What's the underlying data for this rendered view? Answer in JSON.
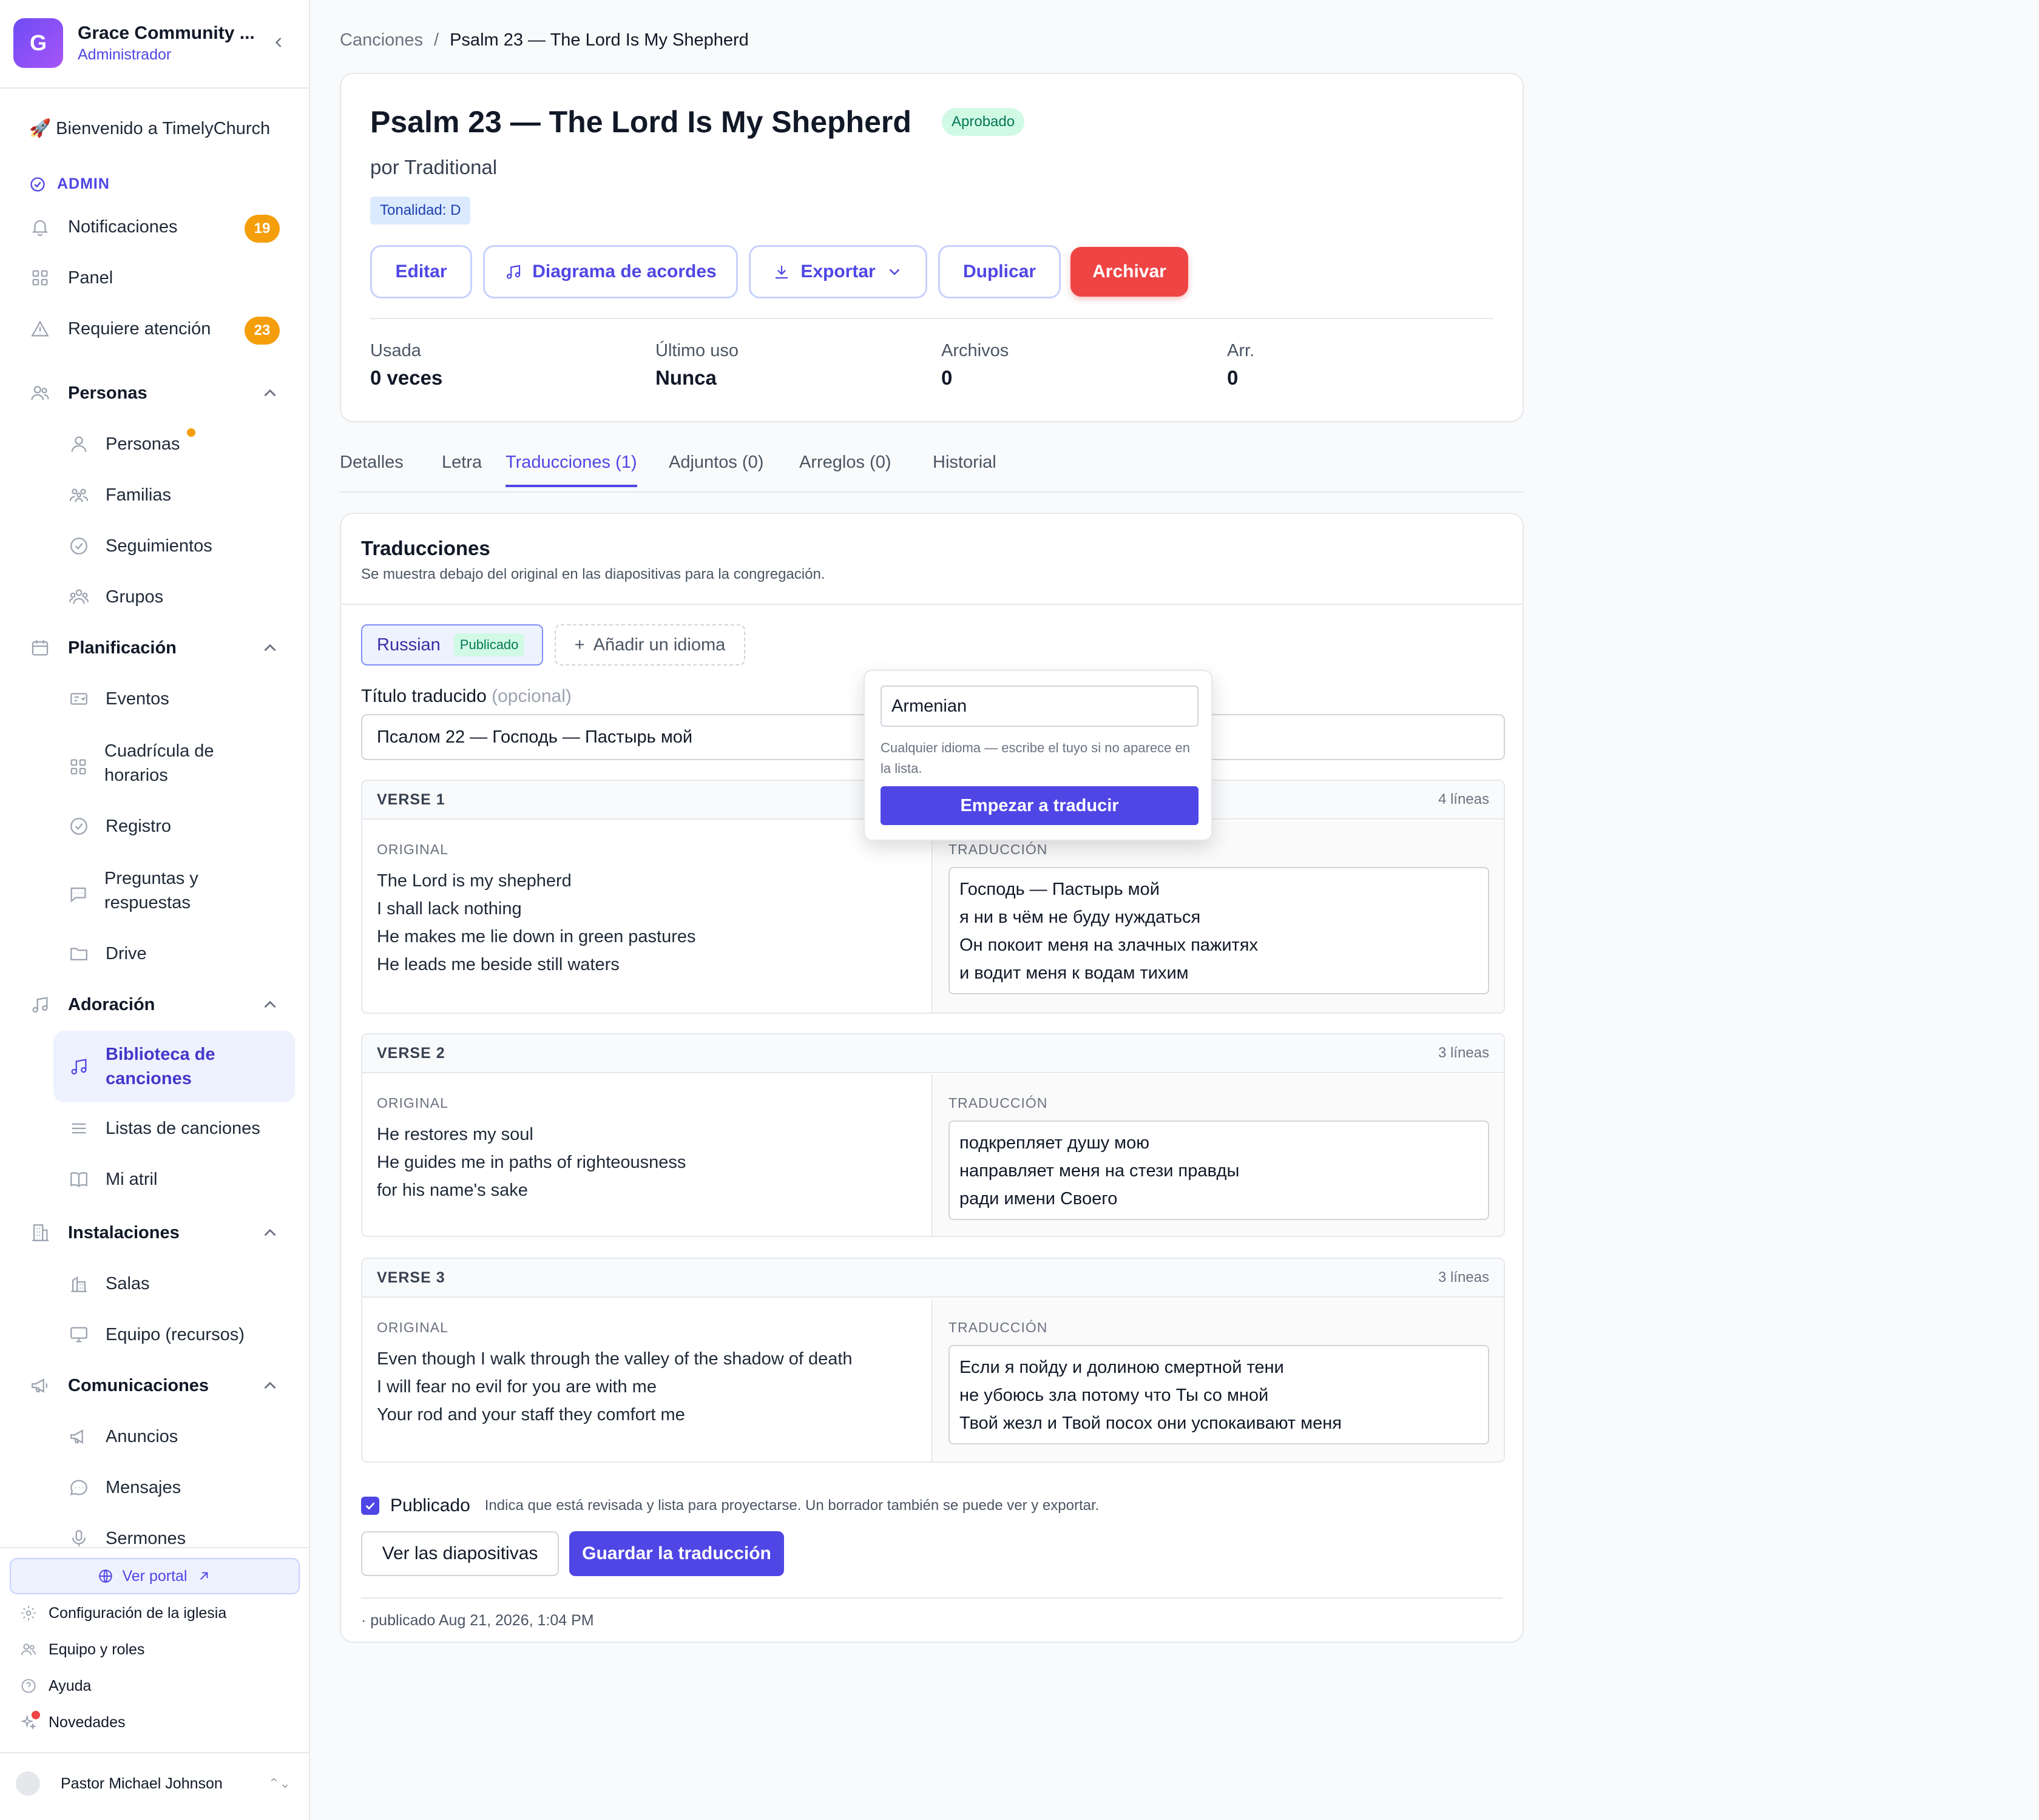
{
  "sidebar": {
    "org_initial": "G",
    "org_name": "Grace Community ...",
    "org_role": "Administrador",
    "welcome": "🚀 Bienvenido a TimelyChurch",
    "admin_label": "ADMIN",
    "top_items": [
      {
        "label": "Notificaciones",
        "badge": "19",
        "icon": "bell-icon"
      },
      {
        "label": "Panel",
        "icon": "grid-icon"
      },
      {
        "label": "Requiere atención",
        "badge": "23",
        "icon": "warning-icon"
      }
    ],
    "groups": {
      "personas": {
        "label": "Personas",
        "items": [
          "Personas",
          "Familias",
          "Seguimientos",
          "Grupos"
        ]
      },
      "planificacion": {
        "label": "Planificación",
        "items": [
          "Eventos",
          "Cuadrícula de horarios",
          "Registro",
          "Preguntas y respuestas",
          "Drive"
        ]
      },
      "adoracion": {
        "label": "Adoración",
        "items": [
          "Biblioteca de canciones",
          "Listas de canciones",
          "Mi atril"
        ]
      },
      "instalaciones": {
        "label": "Instalaciones",
        "items": [
          "Salas",
          "Equipo (recursos)"
        ]
      },
      "comunicaciones": {
        "label": "Comunicaciones",
        "items": [
          "Anuncios",
          "Mensajes",
          "Sermones"
        ]
      }
    },
    "portal_label": "Ver portal",
    "footer_items": [
      "Configuración de la iglesia",
      "Equipo y roles",
      "Ayuda",
      "Novedades"
    ],
    "user_name": "Pastor Michael Johnson"
  },
  "breadcrumb": {
    "parent": "Canciones",
    "separator": "/",
    "current": "Psalm 23 — The Lord Is My Shepherd"
  },
  "song": {
    "title": "Psalm 23 — The Lord Is My Shepherd",
    "status": "Aprobado",
    "author": "por Traditional",
    "key": "Tonalidad: D",
    "actions": {
      "edit": "Editar",
      "chords": "Diagrama de acordes",
      "export": "Exportar",
      "duplicate": "Duplicar",
      "archive": "Archivar"
    },
    "stats": [
      {
        "label": "Usada",
        "value": "0 veces"
      },
      {
        "label": "Último uso",
        "value": "Nunca"
      },
      {
        "label": "Archivos",
        "value": "0"
      },
      {
        "label": "Arr.",
        "value": "0"
      }
    ]
  },
  "tabs": [
    "Detalles",
    "Letra",
    "Traducciones (1)",
    "Adjuntos (0)",
    "Arreglos (0)",
    "Historial"
  ],
  "translations": {
    "title": "Traducciones",
    "subtitle": "Se muestra debajo del original en las diapositivas para la congregación.",
    "language": "Russian",
    "language_status": "Publicado",
    "add_language": "Añadir un idioma",
    "field_label": "Título traducido",
    "field_optional": "(opcional)",
    "title_value": "Псалом 22 — Господь — Пастырь мой",
    "col_original": "ORIGINAL",
    "col_translation": "TRADUCCIÓN",
    "verses": [
      {
        "name": "VERSE 1",
        "lines_count": "4 líneas",
        "original": [
          "The Lord is my shepherd",
          "I shall lack nothing",
          "He makes me lie down in green pastures",
          "He leads me beside still waters"
        ],
        "translation": [
          "Господь — Пастырь мой",
          "я ни в чём не буду нуждаться",
          "Он покоит меня на злачных пажитях",
          "и водит меня к водам тихим"
        ]
      },
      {
        "name": "VERSE 2",
        "lines_count": "3 líneas",
        "original": [
          "He restores my soul",
          "He guides me in paths of righteousness",
          "for his name's sake"
        ],
        "translation": [
          "подкрепляет душу мою",
          "направляет меня на стези правды",
          "ради имени Своего"
        ]
      },
      {
        "name": "VERSE 3",
        "lines_count": "3 líneas",
        "original": [
          "Even though I walk through the valley of the shadow of death",
          "I will fear no evil for you are with me",
          "Your rod and your staff they comfort me"
        ],
        "translation": [
          "Если я пойду и долиною смертной тени",
          "не убоюсь зла потому что Ты со мной",
          "Твой жезл и Твой посох они успокаивают меня"
        ]
      }
    ],
    "published_label": "Publicado",
    "published_hint": "Indica que está revisada y lista para proyectarse. Un borrador también se puede ver y exportar.",
    "view_slides": "Ver las diapositivas",
    "save": "Guardar la traducción",
    "published_date": "· publicado Aug 21, 2026, 1:04 PM"
  },
  "popover": {
    "input_value": "Armenian",
    "hint": "Cualquier idioma — escribe el tuyo si no aparece en la lista.",
    "button": "Empezar a traducir"
  }
}
